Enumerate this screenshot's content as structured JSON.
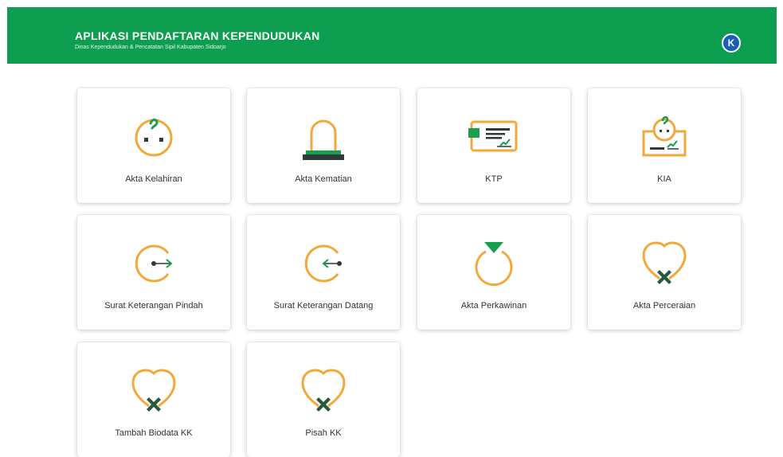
{
  "header": {
    "title": "APLIKASI PENDAFTARAN KEPENDUDUKAN",
    "subtitle": "Dinas Kependudukan & Pencatatan Sipil Kabupaten Sidoarjo",
    "avatar_letter": "K"
  },
  "colors": {
    "header_green": "#0d9e4f",
    "icon_orange": "#f2a93b",
    "icon_green": "#1a9e4f",
    "icon_dark": "#2f3a3b"
  },
  "menu": [
    {
      "label": "Akta Kelahiran",
      "icon": "baby-face-icon"
    },
    {
      "label": "Akta Kematian",
      "icon": "tombstone-icon"
    },
    {
      "label": "KTP",
      "icon": "id-card-icon"
    },
    {
      "label": "KIA",
      "icon": "child-id-card-icon"
    },
    {
      "label": "Surat Keterangan Pindah",
      "icon": "move-out-icon"
    },
    {
      "label": "Surat Keterangan Datang",
      "icon": "move-in-icon"
    },
    {
      "label": "Akta Perkawinan",
      "icon": "ring-icon"
    },
    {
      "label": "Akta Perceraian",
      "icon": "broken-heart-icon"
    },
    {
      "label": "Tambah Biodata KK",
      "icon": "broken-heart-icon"
    },
    {
      "label": "Pisah KK",
      "icon": "broken-heart-icon"
    }
  ]
}
